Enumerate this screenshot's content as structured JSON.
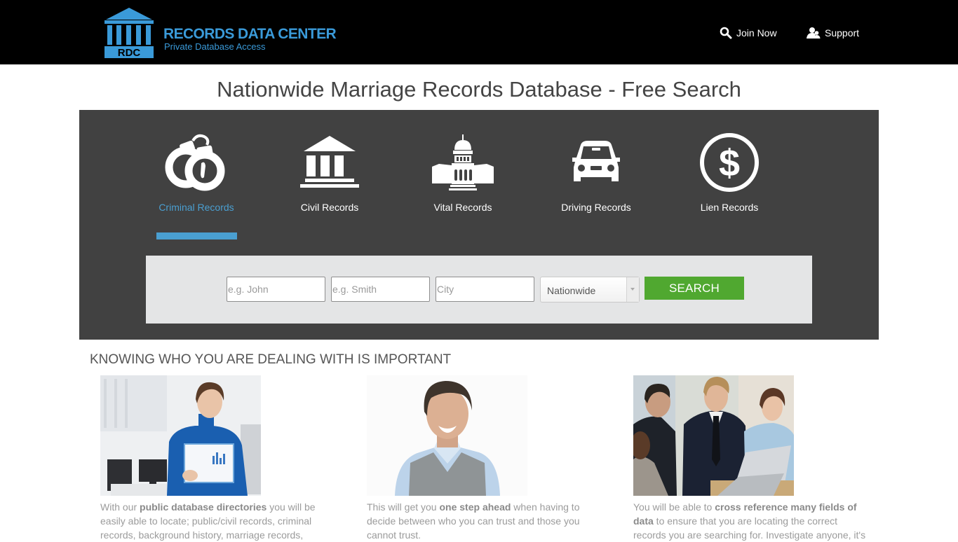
{
  "header": {
    "logo": {
      "badge_text": "RDC",
      "title": "RECORDS DATA CENTER",
      "subtitle": "Private Database Access",
      "brand_color": "#3a9ad9"
    },
    "nav": [
      {
        "label": "Join Now",
        "icon": "search-icon"
      },
      {
        "label": "Support",
        "icon": "users-icon"
      }
    ]
  },
  "page_title": "Nationwide Marriage Records Database - Free Search",
  "categories": {
    "active_index": 0,
    "active_color": "#4a9fd1",
    "items": [
      {
        "label": "Criminal Records",
        "icon": "handcuffs-icon"
      },
      {
        "label": "Civil Records",
        "icon": "courthouse-icon"
      },
      {
        "label": "Vital Records",
        "icon": "capitol-building-icon"
      },
      {
        "label": "Driving Records",
        "icon": "car-icon"
      },
      {
        "label": "Lien Records",
        "icon": "dollar-circle-icon"
      }
    ]
  },
  "search": {
    "first_name": {
      "value": "",
      "placeholder": "e.g. John"
    },
    "last_name": {
      "value": "",
      "placeholder": "e.g. Smith"
    },
    "city": {
      "value": "",
      "placeholder": "City"
    },
    "state": {
      "selected": "Nationwide"
    },
    "button_label": "SEARCH",
    "button_color": "#50a830"
  },
  "info": {
    "heading": "KNOWING WHO YOU ARE DEALING WITH IS IMPORTANT",
    "cards": [
      {
        "image": "woman-holding-folder-photo",
        "text_before": "With our ",
        "text_bold": "public database directories",
        "text_after": " you will be easily able to locate; public/civil records, criminal records, background history, marriage records,"
      },
      {
        "image": "smiling-man-portrait-photo",
        "text_before": "This will get you ",
        "text_bold": "one step ahead",
        "text_after": " when having to decide between who you can trust and those you cannot trust."
      },
      {
        "image": "business-team-laptop-photo",
        "text_before": "You will be able to ",
        "text_bold": "cross reference many fields of data",
        "text_after": " to ensure that you are locating the correct records you are searching for. Investigate anyone, it's"
      }
    ]
  }
}
